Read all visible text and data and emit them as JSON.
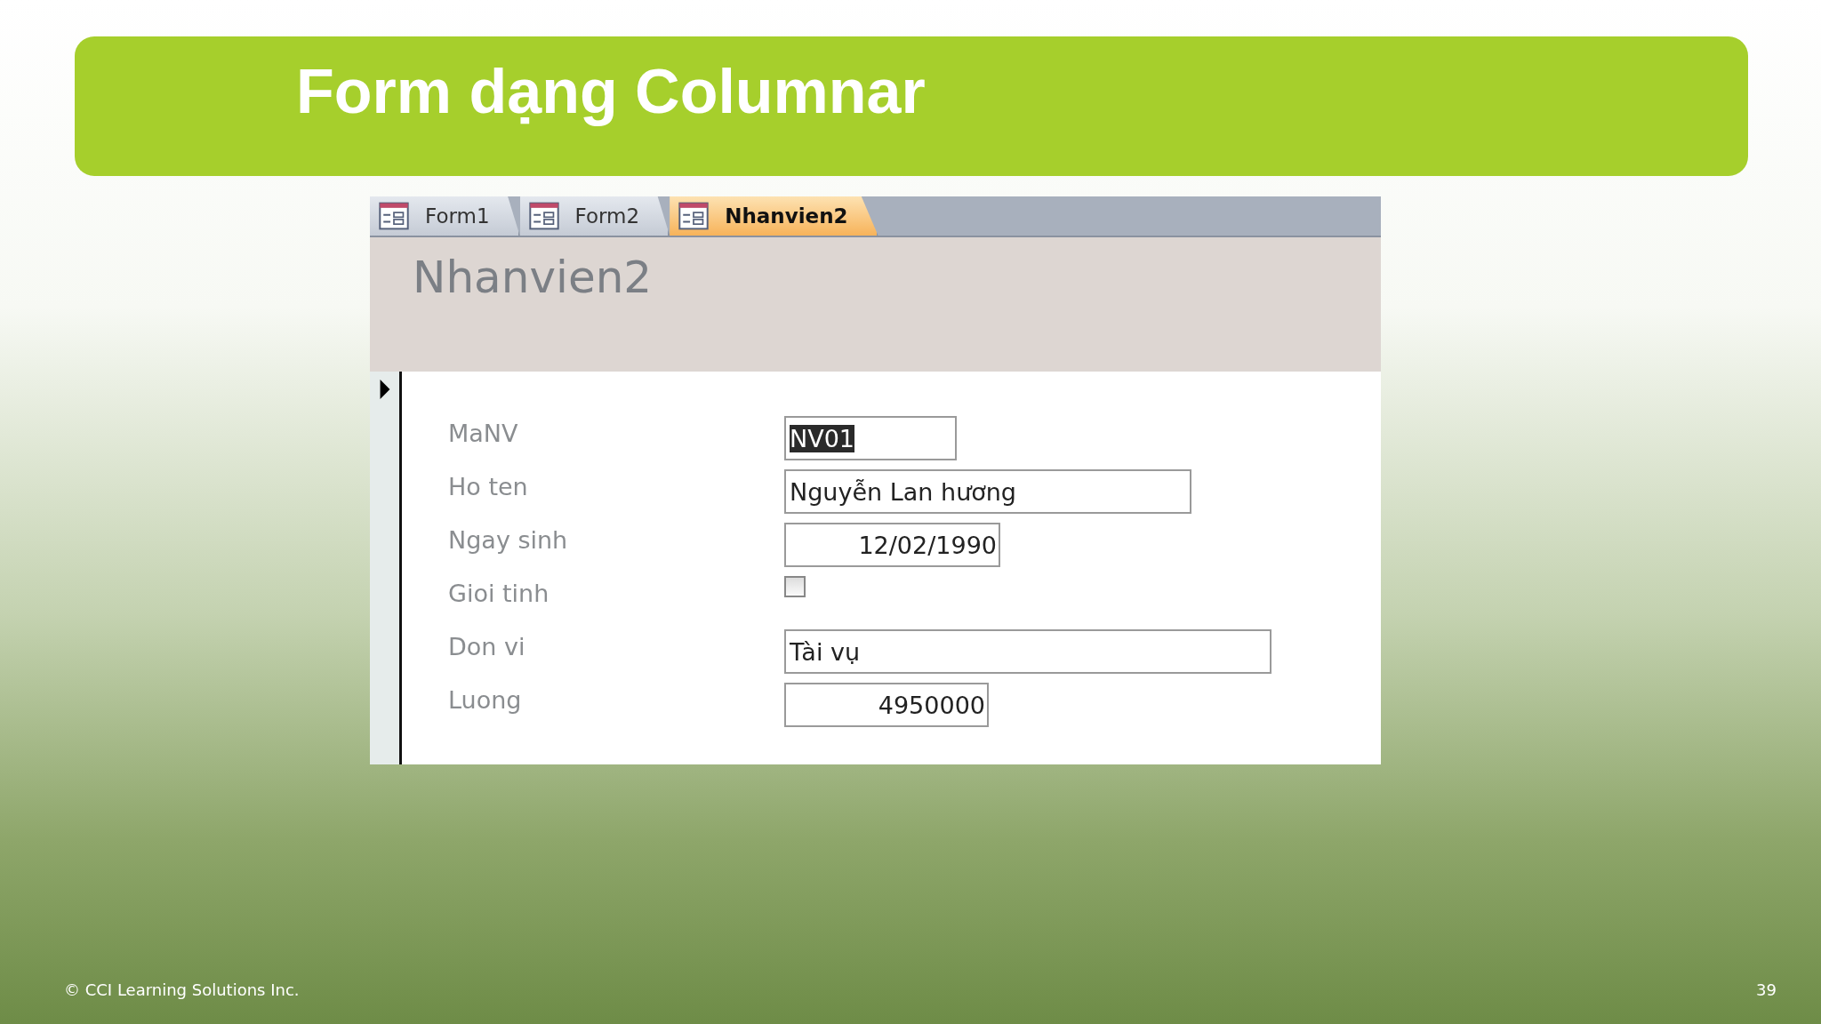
{
  "slide_title": "Form dạng Columnar",
  "tabs": [
    {
      "label": "Form1",
      "selected": false
    },
    {
      "label": "Form2",
      "selected": false
    },
    {
      "label": "Nhanvien2",
      "selected": true
    }
  ],
  "form_header": "Nhanvien2",
  "fields": [
    {
      "label": "MaNV",
      "kind": "text",
      "value": "NV01",
      "highlighted": true
    },
    {
      "label": "Ho ten",
      "kind": "text",
      "value": "Nguyễn Lan hương",
      "highlighted": false
    },
    {
      "label": "Ngay sinh",
      "kind": "date",
      "value": "12/02/1990",
      "highlighted": false
    },
    {
      "label": "Gioi tinh",
      "kind": "checkbox",
      "checked": false
    },
    {
      "label": "Don vi",
      "kind": "text",
      "value": "Tài vụ",
      "highlighted": false
    },
    {
      "label": "Luong",
      "kind": "number",
      "value": "4950000",
      "highlighted": false
    }
  ],
  "footer": {
    "copyright": "© CCI Learning Solutions Inc.",
    "page_number": "39"
  }
}
